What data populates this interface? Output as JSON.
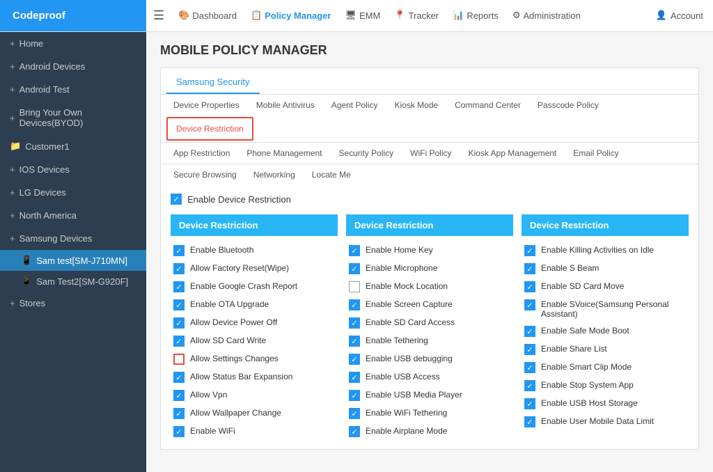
{
  "brand": "Codeproof",
  "topnav": {
    "items": [
      {
        "label": "Dashboard",
        "icon": "🎨",
        "active": false
      },
      {
        "label": "Policy Manager",
        "icon": "📋",
        "active": true
      },
      {
        "label": "EMM",
        "icon": "🖥",
        "active": false
      },
      {
        "label": "Tracker",
        "icon": "📍",
        "active": false
      },
      {
        "label": "Reports",
        "icon": "📊",
        "active": false
      },
      {
        "label": "Administration",
        "icon": "⚙",
        "active": false
      }
    ],
    "account": "Account"
  },
  "sidebar": {
    "items": [
      {
        "label": "Home",
        "type": "root",
        "icon": "+"
      },
      {
        "label": "Android Devices",
        "type": "root",
        "icon": "+"
      },
      {
        "label": "Android Test",
        "type": "root",
        "icon": "+"
      },
      {
        "label": "Bring Your Own Devices(BYOD)",
        "type": "root",
        "icon": "+"
      },
      {
        "label": "Customer1",
        "type": "folder",
        "icon": "📁"
      },
      {
        "label": "IOS Devices",
        "type": "root",
        "icon": "+"
      },
      {
        "label": "LG Devices",
        "type": "root",
        "icon": "+"
      },
      {
        "label": "North America",
        "type": "root",
        "icon": "+"
      },
      {
        "label": "Samsung Devices",
        "type": "root",
        "icon": "+"
      },
      {
        "label": "Sam test[SM-J710MN]",
        "type": "child",
        "active": true
      },
      {
        "label": "Sam Test2[SM-G920F]",
        "type": "child",
        "active": false
      },
      {
        "label": "Stores",
        "type": "root",
        "icon": "+"
      }
    ]
  },
  "page_title": "MOBILE POLICY MANAGER",
  "samsung_sec_tab": "Samsung Security",
  "tab_row1": [
    {
      "label": "Device Properties",
      "active": false
    },
    {
      "label": "Mobile Antivirus",
      "active": false
    },
    {
      "label": "Agent Policy",
      "active": false
    },
    {
      "label": "Kiosk Mode",
      "active": false
    },
    {
      "label": "Command Center",
      "active": false
    },
    {
      "label": "Passcode Policy",
      "active": false
    },
    {
      "label": "Device Restriction",
      "active": true
    }
  ],
  "tab_row2": [
    {
      "label": "App Restriction",
      "active": false
    },
    {
      "label": "Phone Management",
      "active": false
    },
    {
      "label": "Security Policy",
      "active": false
    },
    {
      "label": "WiFi Policy",
      "active": false
    },
    {
      "label": "Kiosk App Management",
      "active": false
    },
    {
      "label": "Email Policy",
      "active": false
    }
  ],
  "tab_row3": [
    {
      "label": "Secure Browsing",
      "active": false
    },
    {
      "label": "Networking",
      "active": false
    },
    {
      "label": "Locate Me",
      "active": false
    }
  ],
  "enable_device_restriction": "Enable Device Restriction",
  "col_headers": [
    "Device Restriction",
    "Device Restriction",
    "Device Restriction"
  ],
  "col1": [
    {
      "label": "Enable Bluetooth",
      "checked": true,
      "highlight": false
    },
    {
      "label": "Allow Factory Reset(Wipe)",
      "checked": true,
      "highlight": false
    },
    {
      "label": "Enable Google Crash Report",
      "checked": true,
      "highlight": false
    },
    {
      "label": "Enable OTA Upgrade",
      "checked": true,
      "highlight": false
    },
    {
      "label": "Allow Device Power Off",
      "checked": true,
      "highlight": false
    },
    {
      "label": "Allow SD Card Write",
      "checked": true,
      "highlight": false
    },
    {
      "label": "Allow Settings Changes",
      "checked": false,
      "highlight": true
    },
    {
      "label": "Allow Status Bar Expansion",
      "checked": true,
      "highlight": false
    },
    {
      "label": "Allow Vpn",
      "checked": true,
      "highlight": false
    },
    {
      "label": "Allow Wallpaper Change",
      "checked": true,
      "highlight": false
    },
    {
      "label": "Enable WiFi",
      "checked": true,
      "highlight": false
    }
  ],
  "col2": [
    {
      "label": "Enable Home Key",
      "checked": true,
      "highlight": false
    },
    {
      "label": "Enable Microphone",
      "checked": true,
      "highlight": false
    },
    {
      "label": "Enable Mock Location",
      "checked": false,
      "highlight": false
    },
    {
      "label": "Enable Screen Capture",
      "checked": true,
      "highlight": false
    },
    {
      "label": "Enable SD Card Access",
      "checked": true,
      "highlight": false
    },
    {
      "label": "Enable Tethering",
      "checked": true,
      "highlight": false
    },
    {
      "label": "Enable USB debugging",
      "checked": true,
      "highlight": false
    },
    {
      "label": "Enable USB Access",
      "checked": true,
      "highlight": false
    },
    {
      "label": "Enable USB Media Player",
      "checked": true,
      "highlight": false
    },
    {
      "label": "Enable WiFi Tethering",
      "checked": true,
      "highlight": false
    },
    {
      "label": "Enable Airplane Mode",
      "checked": true,
      "highlight": false
    }
  ],
  "col3": [
    {
      "label": "Enable Killing Activities on Idle",
      "checked": true,
      "highlight": false
    },
    {
      "label": "Enable S Beam",
      "checked": true,
      "highlight": false
    },
    {
      "label": "Enable SD Card Move",
      "checked": true,
      "highlight": false
    },
    {
      "label": "Enable SVoice(Samsung Personal Assistant)",
      "checked": true,
      "highlight": false
    },
    {
      "label": "Enable Safe Mode Boot",
      "checked": true,
      "highlight": false
    },
    {
      "label": "Enable Share List",
      "checked": true,
      "highlight": false
    },
    {
      "label": "Enable Smart Clip Mode",
      "checked": true,
      "highlight": false
    },
    {
      "label": "Enable Stop System App",
      "checked": true,
      "highlight": false
    },
    {
      "label": "Enable USB Host Storage",
      "checked": true,
      "highlight": false
    },
    {
      "label": "Enable User Mobile Data Limit",
      "checked": true,
      "highlight": false
    }
  ]
}
